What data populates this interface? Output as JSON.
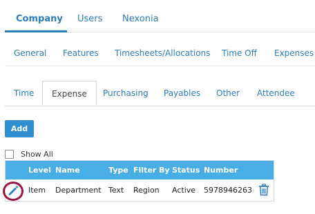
{
  "top_tabs": [
    {
      "label": "Company",
      "active": true
    },
    {
      "label": "Users",
      "active": false
    },
    {
      "label": "Nexonia",
      "active": false
    }
  ],
  "sub_nav": [
    "General",
    "Features",
    "Timesheets/Allocations",
    "Time Off",
    "Expenses"
  ],
  "section_tabs": [
    {
      "label": "Time",
      "active": false
    },
    {
      "label": "Expense",
      "active": true
    },
    {
      "label": "Purchasing",
      "active": false
    },
    {
      "label": "Payables",
      "active": false
    },
    {
      "label": "Other",
      "active": false
    },
    {
      "label": "Attendee",
      "active": false
    }
  ],
  "add_button": "Add",
  "show_all": {
    "label": "Show All",
    "checked": false
  },
  "table": {
    "headers": [
      "Level",
      "Name",
      "Type",
      "Filter By",
      "Status",
      "Number"
    ],
    "rows": [
      [
        "Item",
        "Department",
        "Text",
        "Region",
        "Active",
        "5978946263"
      ]
    ]
  },
  "colors": {
    "accent": "#2b7dbb",
    "header_bg": "#4aaee6",
    "button_bg": "#2f8fd0",
    "highlight_circle": "#9c1446"
  },
  "icons": {
    "edit": "pencil-icon",
    "delete": "trash-icon"
  }
}
